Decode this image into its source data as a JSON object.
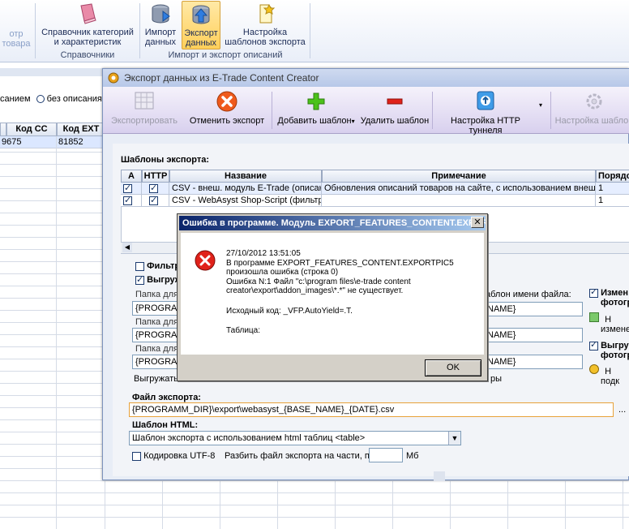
{
  "ribbon": {
    "partial_left_top": "отр",
    "partial_left_bottom": "товара",
    "btn_categories_line1": "Справочник категорий",
    "btn_categories_line2": "и характеристик",
    "group_refs": "Справочники",
    "btn_import_line1": "Импорт",
    "btn_import_line2": "данных",
    "btn_export_line1": "Экспорт",
    "btn_export_line2": "данных",
    "btn_templates_line1": "Настройка",
    "btn_templates_line2": "шаблонов экспорта",
    "group_import_export": "Импорт и экспорт описаний"
  },
  "grid": {
    "filter_partial": "санием",
    "filter_without": "без описания",
    "col_kod_cc": "Код CC",
    "col_kod_ext": "Код EXT",
    "row1_cc": "9675",
    "row1_ext": "81852"
  },
  "export_window": {
    "title": "Экспорт данных из E-Trade Content Creator",
    "toolbar": {
      "export": "Экспортировать",
      "cancel": "Отменить экспорт",
      "add": "Добавить шаблон",
      "delete": "Удалить шаблон",
      "http": "Настройка HTTP туннеля",
      "tpl_settings": "Настройка шаблон"
    },
    "templates_label": "Шаблоны экспорта:",
    "columns": {
      "a": "A",
      "http": "HTTP",
      "name": "Название",
      "note": "Примечание",
      "order": "Порядо"
    },
    "rows": [
      {
        "name": "CSV - внеш. модуль E-Trade (описания)",
        "note": "Обновления описаний товаров на сайте, с использованием внешнего м",
        "order": "1"
      },
      {
        "name": "CSV - WebAsyst Shop-Script (фильтраци",
        "note": "",
        "order": "1"
      }
    ],
    "filter_partial": "Фильтр",
    "upload_partial": "Выгруж",
    "folder_partial1": "Папка для",
    "folder_partial2": "Папка для",
    "folder_partial3": "Папка для",
    "programm_partial": "{PROGRAMM",
    "upload_text_partial": "Выгружать",
    "file_name_tpl_partial": "аблон имени файла:",
    "name_value": "NAME}",
    "rye_partial": "ры",
    "right_rename_1": "Измен",
    "right_rename_2": "фотогр",
    "right_na": "Н",
    "right_izmen": "измене",
    "right_upload_1": "Выгру",
    "right_upload_2": "фотогр",
    "right_na2": "Н",
    "right_podk": "подк",
    "export_file_label": "Файл экспорта:",
    "export_file_value": "{PROGRAMM_DIR}\\export\\webasyst_{BASE_NAME}_{DATE}.csv",
    "ellipsis": "...",
    "html_tpl_label": "Шаблон HTML:",
    "html_tpl_value": "Шаблон экспорта с использованием html таблиц <table>",
    "utf8_label": "Кодировка UTF-8",
    "split_label": "Разбить файл экспорта на части, по:",
    "mb": "Мб"
  },
  "error_dialog": {
    "title": "Ошибка в программе. Модуль EXPORT_FEATURES_CONTENT.EXPOR...",
    "line1": "27/10/2012 13:51:05",
    "line2": "В программе EXPORT_FEATURES_CONTENT.EXPORTPIC5",
    "line3": "произошла ошибка (строка 0)",
    "line4": "Ошибка N:1 Файл \"c:\\program files\\e-trade content",
    "line5": "creator\\export\\addon_images\\*.*\" не существует.",
    "line6": "Исходный код: _VFP.AutoYield=.T.",
    "line7": "Таблица:",
    "ok": "OK"
  }
}
